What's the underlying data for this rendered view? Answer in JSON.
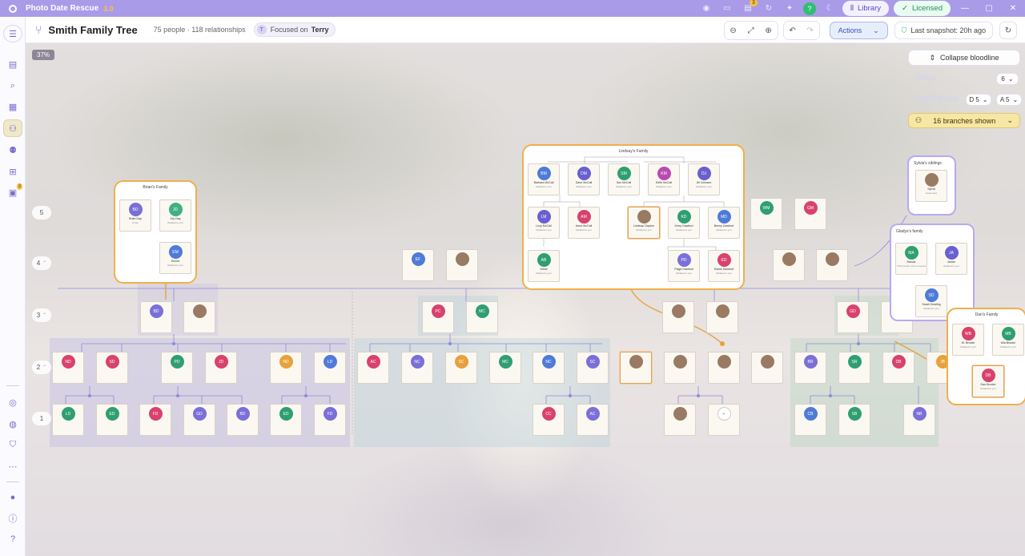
{
  "app": {
    "name": "Photo Date Rescue",
    "version": "3.0",
    "library_label": "Library",
    "licensed_label": "Licensed",
    "badge_count": "3"
  },
  "toolbar": {
    "title": "Smith Family Tree",
    "counts": "75 people · 118 relationships",
    "focus_prefix": "Focused on",
    "focus_name": "Terry",
    "actions_label": "Actions",
    "snapshot_label": "Last snapshot: 20h ago"
  },
  "canvas": {
    "zoom": "37%",
    "generations": [
      "5",
      "4",
      "3",
      "2",
      "1"
    ],
    "controls": {
      "collapse_label": "Collapse bloodline",
      "steps_label": "Steps",
      "steps_value": "6",
      "generations_label": "Generations",
      "desc_value": "D 5",
      "asc_value": "A 5",
      "branches_label": "16 branches shown"
    }
  },
  "families": {
    "brian": {
      "title": "Brian's Family"
    },
    "lindsay": {
      "title": "Lindsay's Family"
    },
    "sylvia": {
      "title": "Sylvia's siblings"
    },
    "gladys": {
      "title": "Gladys's family"
    },
    "dan": {
      "title": "Dan's Family"
    }
  },
  "people": [
    {
      "id": "p1",
      "initials": "BD",
      "name": "Brian Day",
      "rel": "Uncle",
      "color": "#7b6fd8"
    },
    {
      "id": "p2",
      "initials": "JD",
      "name": "Joy Day",
      "rel": "Related to you",
      "color": "#3fb27f"
    },
    {
      "id": "p3",
      "initials": "EM",
      "name": "Emma",
      "rel": "Related to you",
      "color": "#4f7bd8"
    },
    {
      "id": "p4",
      "initials": "BM",
      "name": "Barbara McCall",
      "rel": "Related to you",
      "color": "#4f7bd8"
    },
    {
      "id": "p5",
      "initials": "DM",
      "name": "Dave McCall",
      "rel": "Related to you",
      "color": "#6a5fd0"
    },
    {
      "id": "p6",
      "initials": "SM",
      "name": "Sue McCall",
      "rel": "Related to you",
      "color": "#2f9f6f"
    },
    {
      "id": "p7",
      "initials": "KM",
      "name": "Keith McCall",
      "rel": "Related to you",
      "color": "#b84bb0"
    },
    {
      "id": "p8",
      "initials": "DJ",
      "name": "Jill Johnson",
      "rel": "Related to you",
      "color": "#6a5fd0"
    },
    {
      "id": "p9",
      "initials": "LM",
      "name": "Lucy McCall",
      "rel": "Related to you",
      "color": "#6a5fd0"
    },
    {
      "id": "p10",
      "initials": "AM",
      "name": "Anne McCall",
      "rel": "Related to you",
      "color": "#d8426b"
    },
    {
      "id": "p11",
      "initials": "LC",
      "name": "Lindsay Clapton",
      "rel": "Related to you",
      "color": "#9a7a62"
    },
    {
      "id": "p12",
      "initials": "KD",
      "name": "Kerry Dawford",
      "rel": "Related to you",
      "color": "#2f9f6f"
    },
    {
      "id": "p13",
      "initials": "MD",
      "name": "Benny Dawford",
      "rel": "Related to you",
      "color": "#4f7bd8"
    },
    {
      "id": "p14",
      "initials": "AB",
      "name": "Arline",
      "rel": "Related to you",
      "color": "#2f9f6f"
    },
    {
      "id": "p15",
      "initials": "PD",
      "name": "Paige Dawford",
      "rel": "Related to you",
      "color": "#7b6fd8"
    },
    {
      "id": "p16",
      "initials": "ED",
      "name": "Elaine Dawford",
      "rel": "Related to you",
      "color": "#d8426b"
    },
    {
      "id": "p17",
      "initials": "SY",
      "name": "Sylvia",
      "rel": "Great aunt",
      "color": "#9a7a62"
    },
    {
      "id": "p18",
      "initials": "MA",
      "name": "Marcia",
      "rel": "Third cousin once removed",
      "color": "#2f9f6f"
    },
    {
      "id": "p19",
      "initials": "JA",
      "name": "Janice",
      "rel": "Related to you",
      "color": "#6a5fd0"
    },
    {
      "id": "p20",
      "initials": "SD",
      "name": "Sarah Dowling",
      "rel": "Related to you",
      "color": "#4f7bd8"
    },
    {
      "id": "p21",
      "initials": "WB",
      "name": "W. Brooke",
      "rel": "Related to you",
      "color": "#d8426b"
    },
    {
      "id": "p22",
      "initials": "MB",
      "name": "Mia Brooke",
      "rel": "Related to you",
      "color": "#2f9f6f"
    },
    {
      "id": "p23",
      "initials": "DB",
      "name": "Dan Brooke",
      "rel": "Related to you",
      "color": "#d8426b"
    }
  ]
}
